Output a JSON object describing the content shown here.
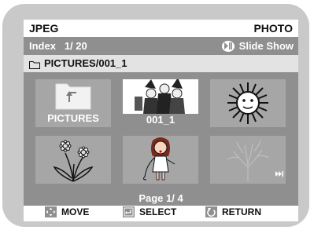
{
  "header": {
    "format": "JPEG",
    "mode": "PHOTO"
  },
  "info": {
    "index_label": "Index",
    "index_value": "1/ 20",
    "slideshow_label": "Slide Show"
  },
  "path": {
    "text": "PICTURES/001_1"
  },
  "thumbnails": [
    {
      "label": "PICTURES",
      "icon": "folder-up-icon"
    },
    {
      "label": "001_1",
      "icon": "halloween-characters-image"
    },
    {
      "label": "",
      "icon": "sun-face-image"
    },
    {
      "label": "",
      "icon": "daisy-flowers-image"
    },
    {
      "label": "",
      "icon": "singer-girl-image"
    },
    {
      "label": "",
      "icon": "faded-tree-image"
    }
  ],
  "pager": {
    "text": "Page 1/ 4"
  },
  "buttons": {
    "move": "MOVE",
    "select": "SELECT",
    "return": "RETURN"
  },
  "colors": {
    "panel_gray": "#8f8f8f",
    "frame_gray": "#c9c9c9",
    "cell_gray": "#a6a6a6",
    "selected_cell": "#ffffff"
  }
}
